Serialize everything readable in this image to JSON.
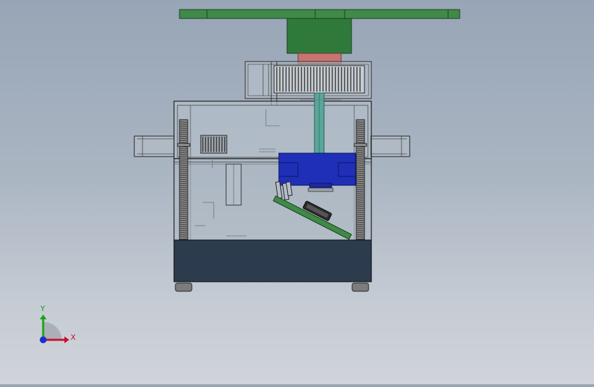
{
  "view": {
    "axes": {
      "x_label": "X",
      "y_label": "Y",
      "x_color": "#c8102e",
      "y_color": "#1aa31a",
      "z_color": "#1a2fd0"
    }
  },
  "colors": {
    "horn": "#3f8a48",
    "horn_dark": "#1f4a26",
    "hub": "#2f7a3a",
    "shaft_ring": "#c87470",
    "gear_fill": "#c7cdd3",
    "shaft": "#5aa79a",
    "motor": "#1f2fb8",
    "pcb": "#3e8a46",
    "case_bottom": "#2c3b4d",
    "case_outline": "#1c1c1c",
    "screw": "#6b6b6b"
  }
}
